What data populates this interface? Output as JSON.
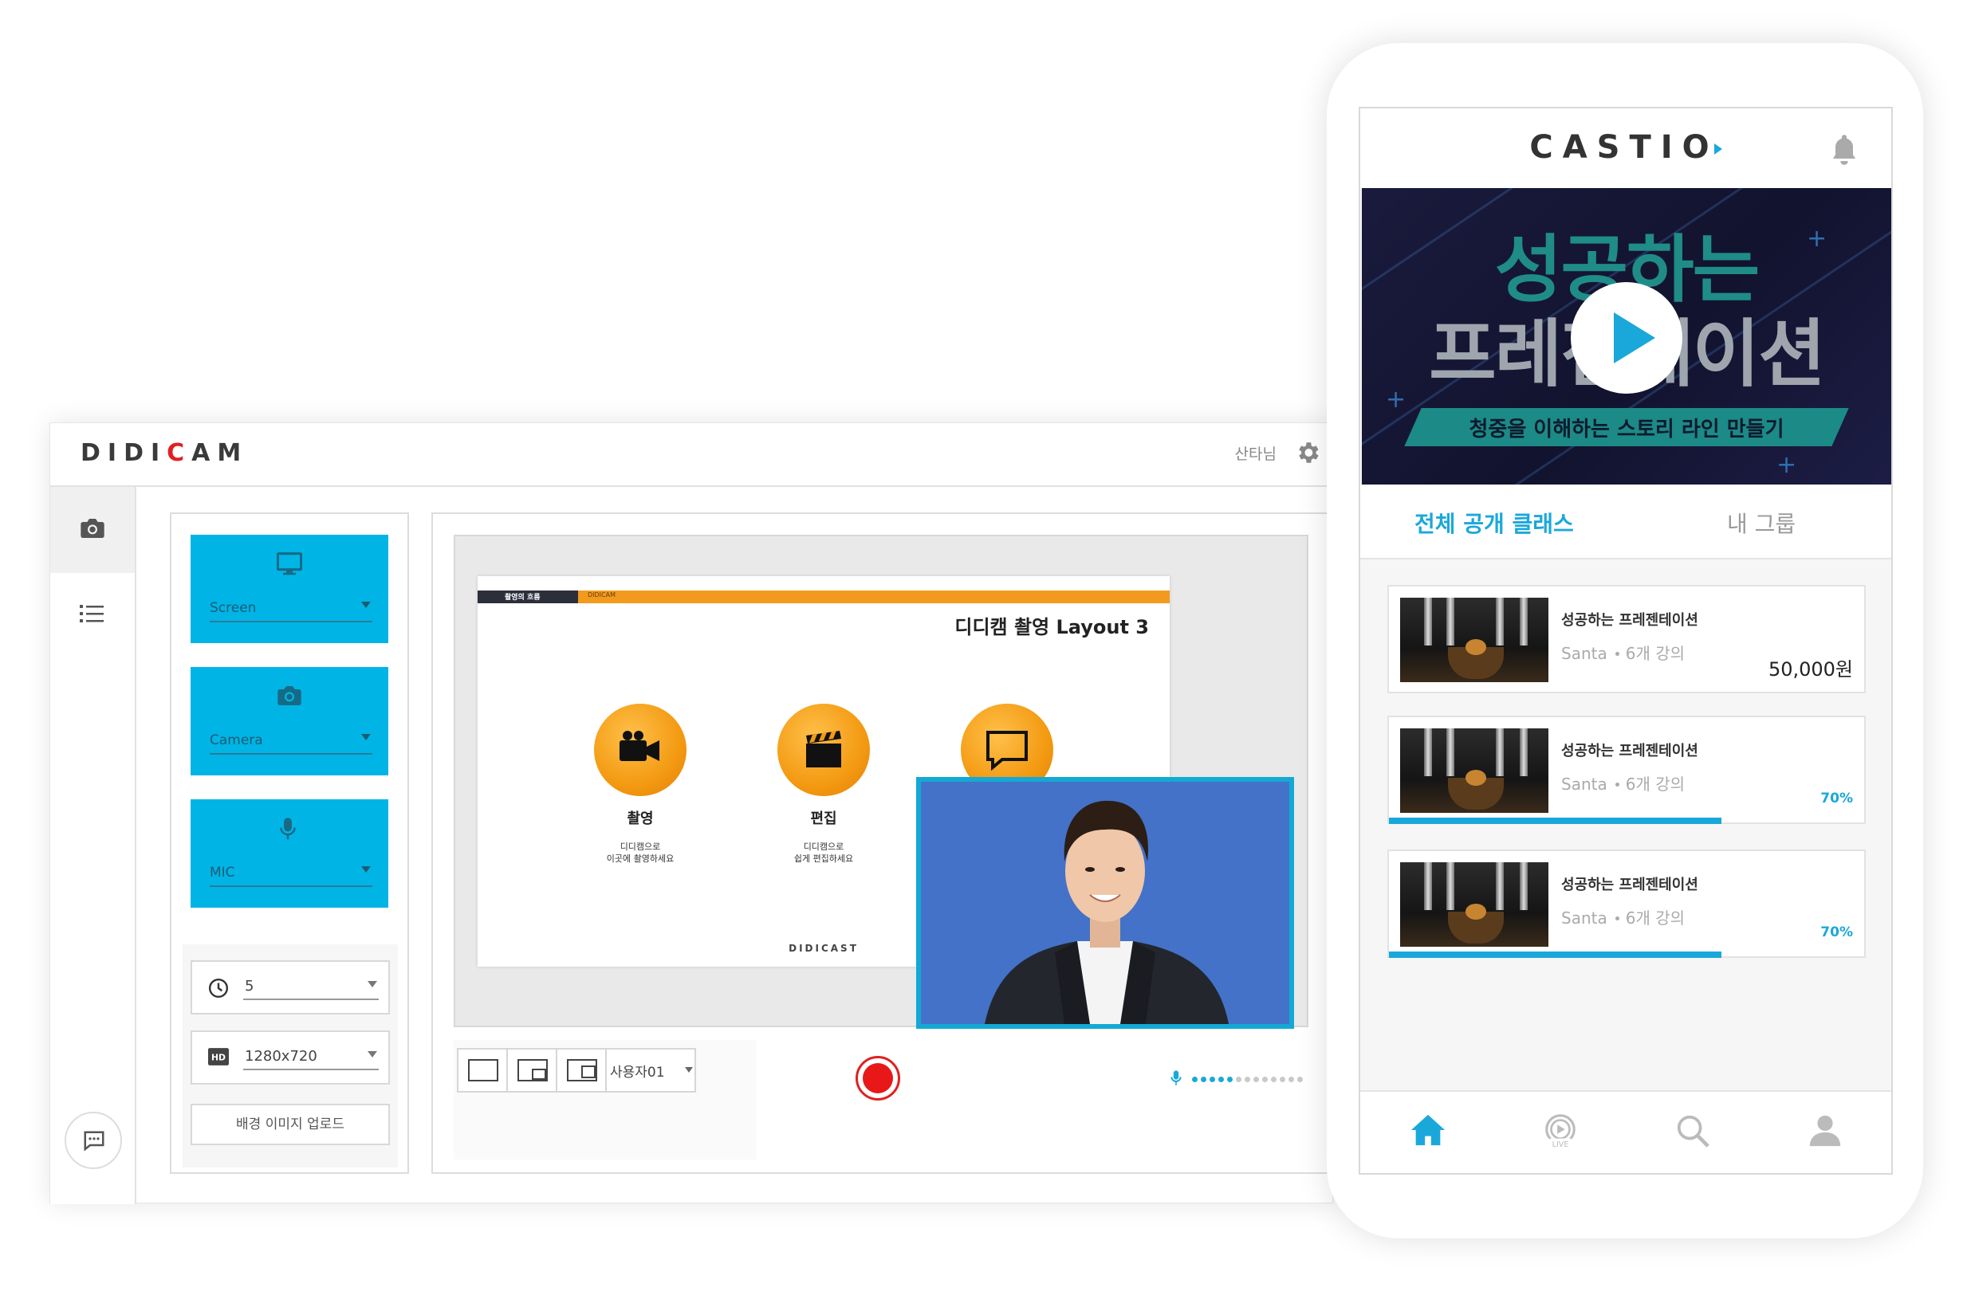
{
  "desktop": {
    "logo_prefix": "DIDI",
    "logo_red": "C",
    "logo_suffix": "AM",
    "user_name": "산타님",
    "sources": [
      {
        "label": "Screen",
        "icon": "monitor-icon"
      },
      {
        "label": "Camera",
        "icon": "camera-icon"
      },
      {
        "label": "MIC",
        "icon": "microphone-icon"
      }
    ],
    "settings": {
      "timer_value": "5",
      "resolution_value": "1280x720",
      "upload_label": "배경 이미지 업로드"
    },
    "slide": {
      "bar_tag": "촬영의 흐름",
      "bar_tag2": "DIDICAM",
      "title": "디디캠 촬영 Layout 3",
      "items": [
        {
          "label": "촬영",
          "desc": "디디캠으로\n이곳에 촬영하세요"
        },
        {
          "label": "편집",
          "desc": "디디캠으로\n쉽게 편집하세요"
        }
      ],
      "footer": "DIDICAST"
    },
    "controls": {
      "user_select": "사용자01"
    },
    "mic_level": 0.4
  },
  "phone": {
    "logo": "CASTIO",
    "banner": {
      "headline1": "성공하는",
      "headline2": "프레젠테이션",
      "subtitle": "청중을 이해하는 스토리 라인 만들기"
    },
    "tabs": [
      {
        "label": "전체 공개 클래스",
        "active": true
      },
      {
        "label": "내 그룹",
        "active": false
      }
    ],
    "classes": [
      {
        "title": "성공하는 프레젠테이션",
        "author": "Santa",
        "lectures": "6개 강의",
        "price": "50,000원"
      },
      {
        "title": "성공하는 프레젠테이션",
        "author": "Santa",
        "lectures": "6개 강의",
        "progress_label": "70%",
        "progress": 0.7
      },
      {
        "title": "성공하는 프레젠테이션",
        "author": "Santa",
        "lectures": "6개 강의",
        "progress_label": "70%",
        "progress": 0.7
      }
    ],
    "nav": [
      "home-icon",
      "live-icon",
      "search-icon",
      "profile-icon"
    ],
    "accent_color": "#1aa8db"
  }
}
